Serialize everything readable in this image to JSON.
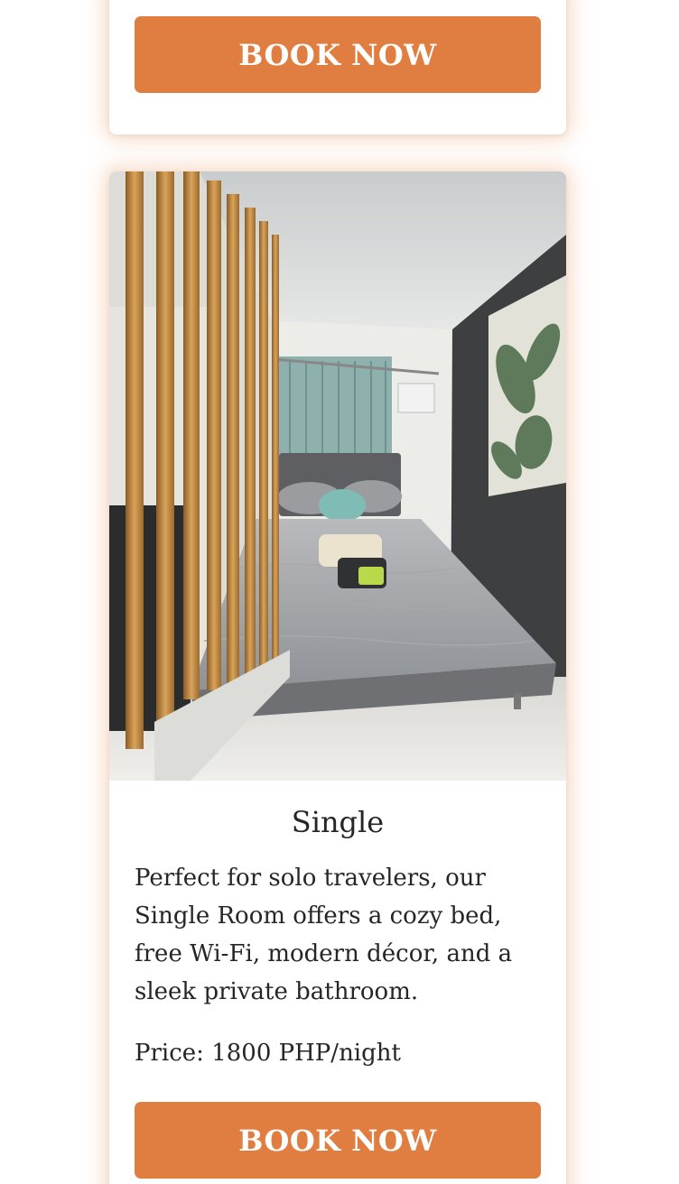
{
  "previous_card": {
    "book_button_label": "BOOK NOW"
  },
  "room_card": {
    "image_alt": "Single room with bed, teal curtains and wooden slat divider",
    "title": "Single",
    "description": "Perfect for solo travelers, our Single Room offers a cozy bed, free Wi-Fi, modern décor, and a sleek private bathroom.",
    "price": "Price: 1800 PHP/night",
    "book_button_label": "BOOK NOW"
  },
  "colors": {
    "accent": "#e07e41",
    "card_glow": "#eea06e",
    "text": "#262626"
  }
}
